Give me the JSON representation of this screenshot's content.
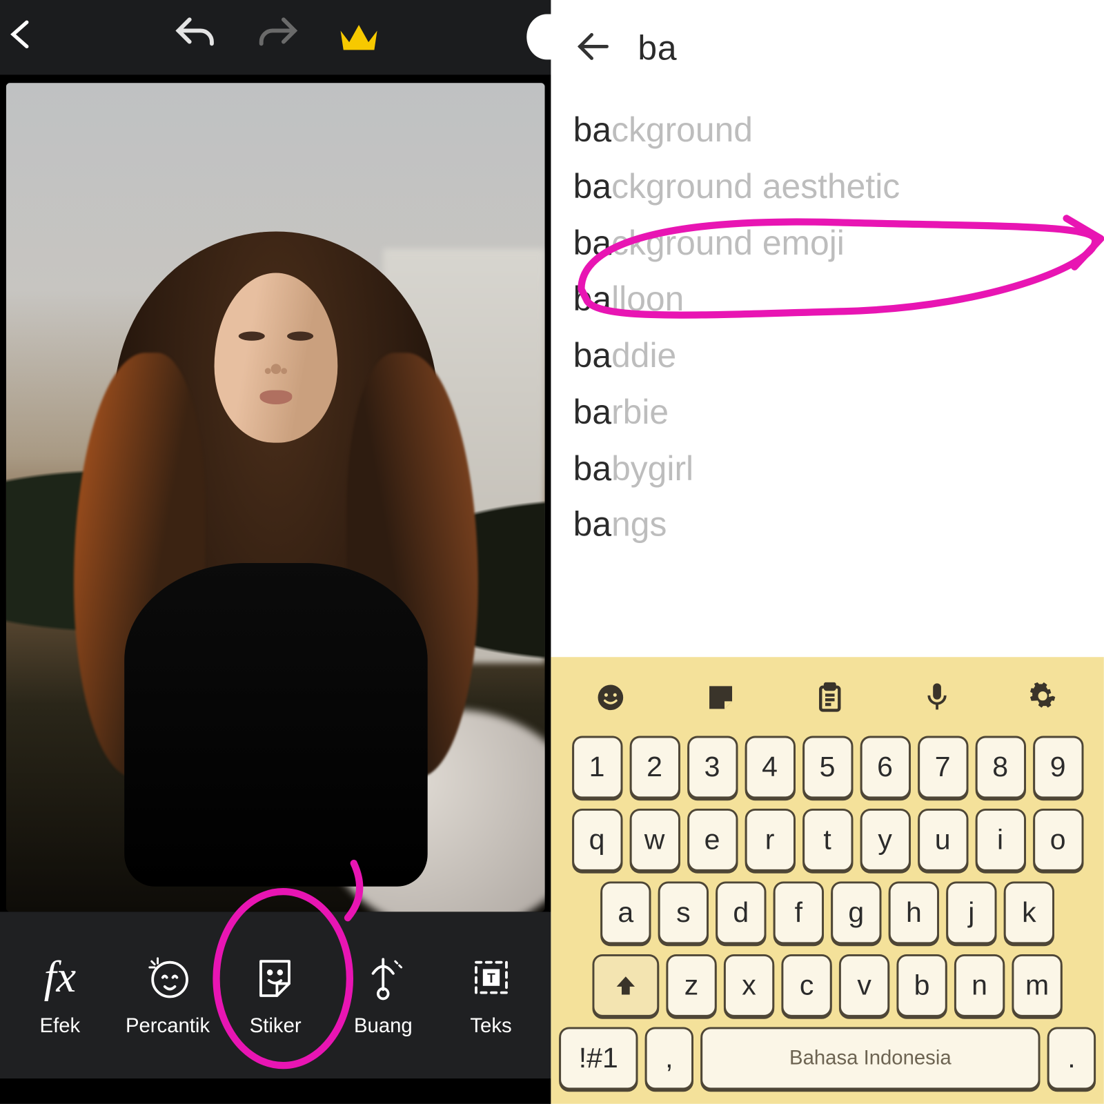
{
  "topbar": {
    "back_icon": "back-arrow",
    "undo_icon": "undo",
    "redo_icon": "redo",
    "premium_icon": "crown"
  },
  "tools": [
    {
      "icon": "fx",
      "label": "Efek",
      "name": "tool-efek"
    },
    {
      "icon": "face",
      "label": "Percantik",
      "name": "tool-percantik"
    },
    {
      "icon": "sticker",
      "label": "Stiker",
      "name": "tool-stiker"
    },
    {
      "icon": "cutout",
      "label": "Buang",
      "name": "tool-buang"
    },
    {
      "icon": "text",
      "label": "Teks",
      "name": "tool-teks"
    }
  ],
  "search": {
    "query": "ba",
    "back_icon": "back-arrow",
    "suggestions": [
      {
        "prefix": "ba",
        "tail": "ckground"
      },
      {
        "prefix": "ba",
        "tail": "ckground aesthetic"
      },
      {
        "prefix": "ba",
        "tail": "ckground emoji"
      },
      {
        "prefix": "ba",
        "tail": "lloon"
      },
      {
        "prefix": "ba",
        "tail": "ddie"
      },
      {
        "prefix": "ba",
        "tail": "rbie"
      },
      {
        "prefix": "ba",
        "tail": "bygirl"
      },
      {
        "prefix": "ba",
        "tail": "ngs"
      }
    ]
  },
  "keyboard": {
    "toolbar_icons": [
      "emoji",
      "sticker",
      "clipboard",
      "mic",
      "gear"
    ],
    "row_num": [
      "1",
      "2",
      "3",
      "4",
      "5",
      "6",
      "7",
      "8",
      "9"
    ],
    "row_top": [
      "q",
      "w",
      "e",
      "r",
      "t",
      "y",
      "u",
      "i",
      "o"
    ],
    "row_home": [
      "a",
      "s",
      "d",
      "f",
      "g",
      "h",
      "j",
      "k"
    ],
    "row_bot": [
      "z",
      "x",
      "c",
      "v",
      "b",
      "n",
      "m"
    ],
    "shift": "↑",
    "sym": "!#1",
    "comma": ",",
    "dot": ".",
    "space_label": "Bahasa Indonesia"
  },
  "colors": {
    "annotation": "#e815b3",
    "crown": "#f7c900",
    "kbd_bg": "#f4e19a",
    "key_bg": "#fbf6e7",
    "key_border": "#4e4636"
  }
}
